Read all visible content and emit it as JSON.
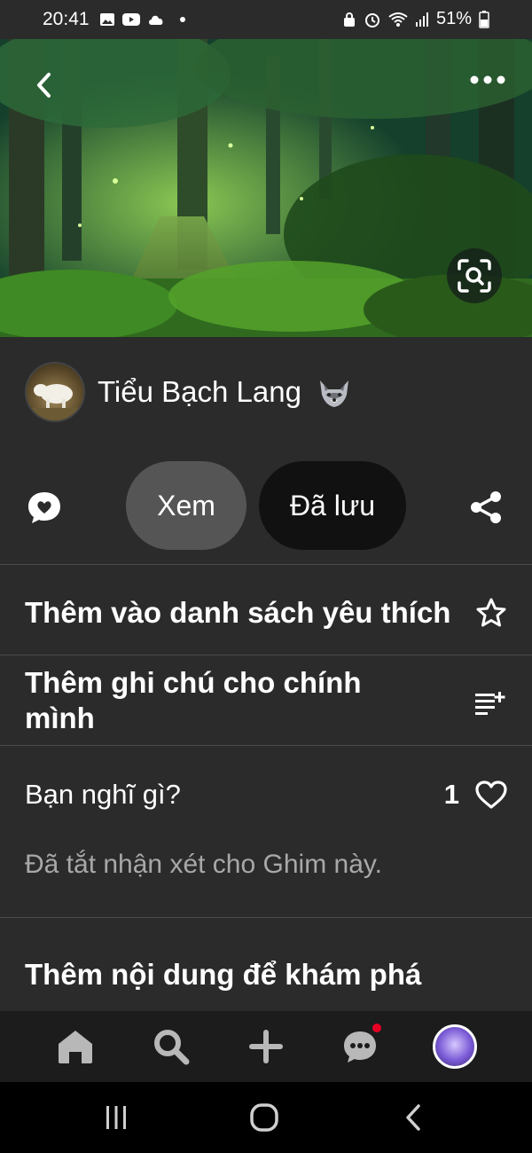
{
  "status_bar": {
    "time": "20:41",
    "battery": "51%",
    "left_icons": [
      "image-icon",
      "youtube-icon",
      "cloud-icon",
      "dot-icon"
    ],
    "right_icons": [
      "lock-icon",
      "alarm-icon",
      "wifi-icon",
      "signal-icon",
      "battery-icon"
    ]
  },
  "hero": {
    "back_icon": "chevron-left-icon",
    "more_icon": "more-horizontal-icon",
    "lens_icon": "visual-search-icon"
  },
  "creator": {
    "name": "Tiểu Bạch Lang"
  },
  "actions": {
    "view_label": "Xem",
    "saved_label": "Đã lưu"
  },
  "favorites": {
    "label": "Thêm vào danh sách yêu thích"
  },
  "note": {
    "label": "Thêm ghi chú cho chính mình"
  },
  "comments": {
    "prompt": "Bạn nghĩ gì?",
    "like_count": "1",
    "disabled_text": "Đã tắt nhận xét cho Ghim này."
  },
  "more": {
    "title": "Thêm nội dung để khám phá"
  },
  "colors": {
    "background": "#2b2b2b",
    "view_button": "#555555",
    "saved_button": "#111111",
    "notification_dot": "#e60023"
  }
}
